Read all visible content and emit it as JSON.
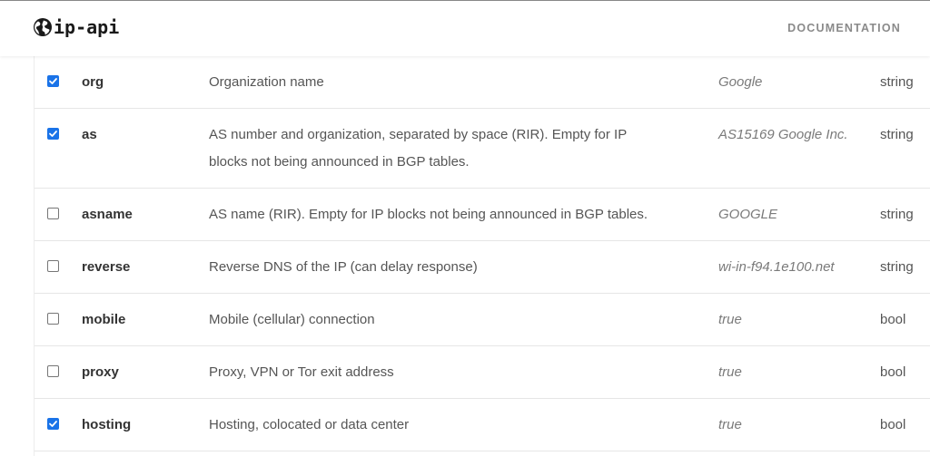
{
  "header": {
    "logo_text": "ip-api",
    "logo_icon": "globe-icon",
    "nav_documentation": "DOCUMENTATION"
  },
  "fields": [
    {
      "checked": true,
      "name": "org",
      "description": "Organization name",
      "example": "Google",
      "type": "string"
    },
    {
      "checked": true,
      "name": "as",
      "description": "AS number and organization, separated by space (RIR). Empty for IP blocks not being announced in BGP tables.",
      "example": "AS15169 Google Inc.",
      "type": "string"
    },
    {
      "checked": false,
      "name": "asname",
      "description": "AS name (RIR). Empty for IP blocks not being announced in BGP tables.",
      "example": "GOOGLE",
      "type": "string"
    },
    {
      "checked": false,
      "name": "reverse",
      "description": "Reverse DNS of the IP (can delay response)",
      "example": "wi-in-f94.1e100.net",
      "type": "string"
    },
    {
      "checked": false,
      "name": "mobile",
      "description": "Mobile (cellular) connection",
      "example": "true",
      "type": "bool"
    },
    {
      "checked": false,
      "name": "proxy",
      "description": "Proxy, VPN or Tor exit address",
      "example": "true",
      "type": "bool"
    },
    {
      "checked": true,
      "name": "hosting",
      "description": "Hosting, colocated or data center",
      "example": "true",
      "type": "bool"
    }
  ],
  "colors": {
    "checkbox_checked": "#1a73e8",
    "text": "#555555",
    "example_text": "#7a7a7a"
  }
}
